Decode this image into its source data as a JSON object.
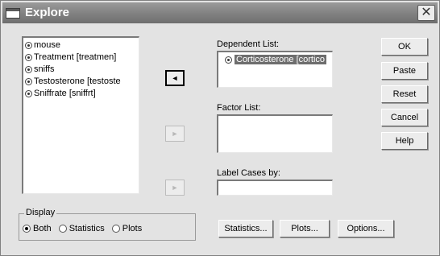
{
  "window": {
    "title": "Explore",
    "close_glyph": "✕"
  },
  "variables": [
    {
      "label": "mouse"
    },
    {
      "label": "Treatment [treatmen]"
    },
    {
      "label": "sniffs"
    },
    {
      "label": "Testosterone [testoste"
    },
    {
      "label": "Sniffrate [sniffrt]"
    }
  ],
  "move_buttons": {
    "dependent": "◄",
    "factor": "►",
    "label_cases": "►"
  },
  "dependent_list": {
    "label": "Dependent List:",
    "items": [
      "Corticosterone [cortico"
    ]
  },
  "factor_list": {
    "label": "Factor List:"
  },
  "label_cases": {
    "label": "Label Cases by:"
  },
  "buttons": {
    "ok": "OK",
    "paste": "Paste",
    "reset": "Reset",
    "cancel": "Cancel",
    "help": "Help",
    "statistics": "Statistics...",
    "plots": "Plots...",
    "options": "Options..."
  },
  "display": {
    "legend": "Display",
    "options": [
      {
        "label": "Both",
        "selected": true
      },
      {
        "label": "Statistics",
        "selected": false
      },
      {
        "label": "Plots",
        "selected": false
      }
    ]
  },
  "icons": {
    "window": "window-icon",
    "variable": "scale-variable-icon"
  }
}
